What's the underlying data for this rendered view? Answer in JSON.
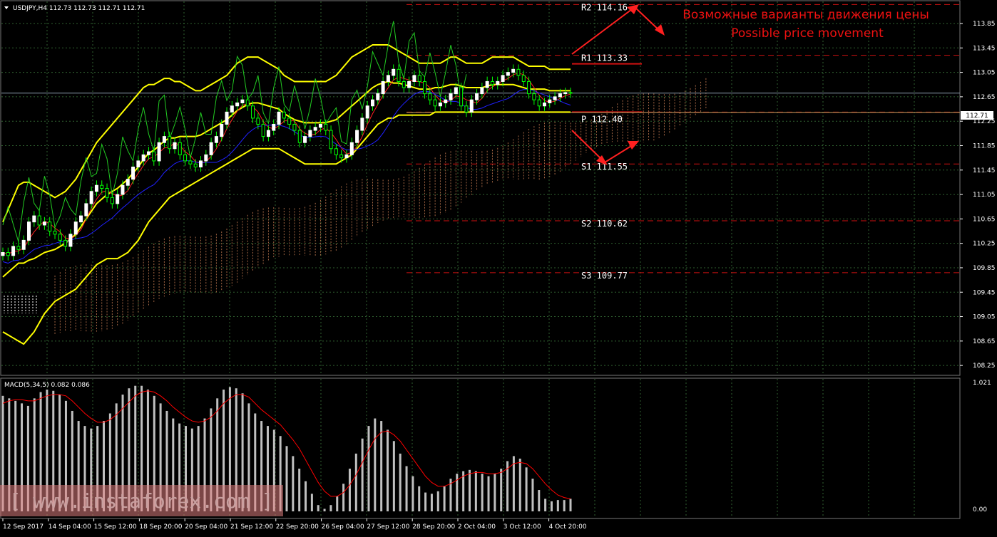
{
  "header": {
    "symbol_line": "USDJPY,H4  112.73 112.73 112.71 112.71"
  },
  "macd_header": "MACD(5,34,5) 0.082 0.086",
  "annotation": {
    "line1": "Возможные варианты движения цены",
    "line2": "Possible price movement"
  },
  "watermark": "[ www.instaforex.com ]",
  "price_tag": "112.71",
  "colors": {
    "background": "#000000",
    "grid": "#2f5f2f",
    "bull": "#ffffff",
    "bear": "#00ff00",
    "bollinger": "#ffff00",
    "tenkan": "#ff2020",
    "kijun": "#2020ff",
    "chikou": "#22cc22",
    "cloud": "#c07850",
    "levels": "#d01010",
    "annotation": "#ff2020",
    "macd_hist": "#c0c0c0",
    "macd_signal": "#ff0000"
  },
  "chart_data": [
    {
      "type": "line",
      "title": "USDJPY,H4",
      "ylim": [
        108.1,
        114.2
      ],
      "y_ticks": [
        "113.85",
        "113.45",
        "113.05",
        "112.65",
        "112.25",
        "111.85",
        "111.45",
        "111.05",
        "110.65",
        "110.25",
        "109.85",
        "109.45",
        "109.05",
        "108.65",
        "108.25"
      ],
      "x_labels": [
        "12 Sep 2017",
        "14 Sep 04:00",
        "15 Sep 12:00",
        "18 Sep 20:00",
        "20 Sep 04:00",
        "21 Sep 12:00",
        "22 Sep 20:00",
        "26 Sep 04:00",
        "27 Sep 12:00",
        "28 Sep 20:00",
        "2 Oct 04:00",
        "3 Oct 12:00",
        "4 Oct 20:00"
      ],
      "levels": [
        {
          "name": "R2",
          "value": "114.16",
          "label": "R2 114.16"
        },
        {
          "name": "R1",
          "value": "113.33",
          "label": "R1 113.33"
        },
        {
          "name": "P",
          "value": "112.40",
          "label": "P 112.40"
        },
        {
          "name": "S1",
          "value": "111.55",
          "label": "S1 111.55"
        },
        {
          "name": "S2",
          "value": "110.62",
          "label": "S2 110.62"
        },
        {
          "name": "S3",
          "value": "109.77",
          "label": "S3 109.77"
        }
      ],
      "last_price": 112.71,
      "close": [
        110.1,
        110.05,
        110.2,
        110.15,
        110.3,
        110.6,
        110.7,
        110.55,
        110.6,
        110.45,
        110.4,
        110.3,
        110.2,
        110.4,
        110.6,
        110.7,
        110.9,
        111.1,
        111.2,
        111.15,
        111.0,
        110.9,
        111.05,
        111.2,
        111.3,
        111.5,
        111.6,
        111.7,
        111.75,
        111.6,
        111.9,
        112.0,
        111.8,
        111.9,
        111.7,
        111.6,
        111.55,
        111.5,
        111.6,
        111.7,
        111.9,
        112.0,
        112.2,
        112.4,
        112.5,
        112.55,
        112.6,
        112.5,
        112.3,
        112.2,
        112.0,
        112.1,
        112.2,
        112.4,
        112.3,
        112.2,
        112.1,
        111.9,
        112.0,
        112.1,
        112.15,
        112.2,
        112.1,
        111.8,
        111.7,
        111.65,
        111.7,
        111.9,
        112.1,
        112.3,
        112.5,
        112.6,
        112.7,
        112.9,
        113.0,
        113.1,
        112.9,
        112.8,
        112.9,
        113.0,
        112.9,
        112.7,
        112.6,
        112.5,
        112.55,
        112.6,
        112.7,
        112.8,
        112.5,
        112.4,
        112.6,
        112.7,
        112.8,
        112.9,
        112.85,
        112.9,
        113.0,
        113.05,
        113.1,
        113.0,
        112.9,
        112.7,
        112.6,
        112.5,
        112.55,
        112.6,
        112.65,
        112.7,
        112.72,
        112.71
      ],
      "bb_upper": [
        110.6,
        110.8,
        111.0,
        111.2,
        111.25,
        111.25,
        111.2,
        111.15,
        111.1,
        111.05,
        111.0,
        111.05,
        111.1,
        111.2,
        111.3,
        111.45,
        111.6,
        111.75,
        111.9,
        112.0,
        112.1,
        112.2,
        112.3,
        112.4,
        112.5,
        112.6,
        112.7,
        112.8,
        112.85,
        112.85,
        112.9,
        112.95,
        112.95,
        112.9,
        112.9,
        112.85,
        112.8,
        112.75,
        112.75,
        112.8,
        112.85,
        112.9,
        112.95,
        113.0,
        113.1,
        113.2,
        113.25,
        113.3,
        113.3,
        113.3,
        113.25,
        113.2,
        113.15,
        113.1,
        113.0,
        112.95,
        112.9,
        112.9,
        112.9,
        112.9,
        112.9,
        112.9,
        112.9,
        112.95,
        113.0,
        113.1,
        113.2,
        113.3,
        113.35,
        113.4,
        113.45,
        113.5,
        113.5,
        113.5,
        113.5,
        113.45,
        113.4,
        113.35,
        113.3,
        113.25,
        113.2,
        113.2,
        113.2,
        113.2,
        113.2,
        113.25,
        113.3,
        113.3,
        113.25,
        113.2,
        113.2,
        113.2,
        113.2,
        113.25,
        113.3,
        113.3,
        113.3,
        113.3,
        113.3,
        113.25,
        113.2,
        113.15,
        113.15,
        113.15,
        113.15,
        113.1,
        113.1,
        113.1,
        113.1,
        113.1
      ],
      "bb_lower": [
        108.8,
        108.75,
        108.7,
        108.65,
        108.6,
        108.7,
        108.8,
        108.95,
        109.1,
        109.2,
        109.3,
        109.35,
        109.4,
        109.45,
        109.5,
        109.6,
        109.7,
        109.8,
        109.9,
        109.95,
        110.0,
        110.0,
        110.0,
        110.05,
        110.1,
        110.2,
        110.3,
        110.45,
        110.6,
        110.7,
        110.8,
        110.9,
        111.0,
        111.05,
        111.1,
        111.15,
        111.2,
        111.25,
        111.3,
        111.35,
        111.4,
        111.45,
        111.5,
        111.55,
        111.6,
        111.65,
        111.7,
        111.75,
        111.8,
        111.8,
        111.8,
        111.8,
        111.8,
        111.8,
        111.75,
        111.7,
        111.65,
        111.6,
        111.55,
        111.55,
        111.55,
        111.55,
        111.55,
        111.55,
        111.55,
        111.6,
        111.65,
        111.7,
        111.8,
        111.9,
        112.0,
        112.1,
        112.2,
        112.25,
        112.3,
        112.3,
        112.35,
        112.35,
        112.35,
        112.35,
        112.35,
        112.35,
        112.35,
        112.4,
        112.4,
        112.4,
        112.4,
        112.4,
        112.4,
        112.4,
        112.4,
        112.4,
        112.4,
        112.4,
        112.4,
        112.4,
        112.4,
        112.4,
        112.4,
        112.4,
        112.4,
        112.4,
        112.4,
        112.4,
        112.4,
        112.4,
        112.4,
        112.4,
        112.4,
        112.4
      ],
      "macd": {
        "ylim": [
          0,
          1.021
        ],
        "ticks": [
          "1.021",
          "0.00"
        ],
        "histogram": [
          0.92,
          0.9,
          0.88,
          0.86,
          0.84,
          0.9,
          0.95,
          0.97,
          0.96,
          0.93,
          0.88,
          0.8,
          0.72,
          0.68,
          0.66,
          0.68,
          0.72,
          0.78,
          0.86,
          0.93,
          0.98,
          1.0,
          1.0,
          0.97,
          0.92,
          0.86,
          0.8,
          0.74,
          0.7,
          0.68,
          0.66,
          0.68,
          0.74,
          0.82,
          0.9,
          0.97,
          0.99,
          0.98,
          0.94,
          0.86,
          0.78,
          0.72,
          0.68,
          0.65,
          0.6,
          0.52,
          0.44,
          0.34,
          0.24,
          0.14,
          0.05,
          0.02,
          0.05,
          0.12,
          0.22,
          0.34,
          0.46,
          0.58,
          0.68,
          0.74,
          0.72,
          0.65,
          0.56,
          0.46,
          0.36,
          0.28,
          0.2,
          0.15,
          0.14,
          0.16,
          0.2,
          0.26,
          0.3,
          0.32,
          0.33,
          0.32,
          0.3,
          0.28,
          0.3,
          0.34,
          0.4,
          0.44,
          0.42,
          0.35,
          0.26,
          0.17,
          0.1,
          0.08,
          0.09,
          0.09,
          0.1
        ],
        "signal": [
          0.86,
          0.88,
          0.89,
          0.89,
          0.88,
          0.88,
          0.9,
          0.92,
          0.93,
          0.93,
          0.92,
          0.88,
          0.83,
          0.78,
          0.74,
          0.71,
          0.71,
          0.73,
          0.77,
          0.82,
          0.87,
          0.92,
          0.95,
          0.96,
          0.95,
          0.92,
          0.88,
          0.83,
          0.79,
          0.75,
          0.72,
          0.71,
          0.72,
          0.75,
          0.8,
          0.86,
          0.9,
          0.93,
          0.93,
          0.91,
          0.86,
          0.81,
          0.77,
          0.73,
          0.69,
          0.63,
          0.57,
          0.5,
          0.41,
          0.32,
          0.23,
          0.16,
          0.12,
          0.12,
          0.15,
          0.21,
          0.29,
          0.39,
          0.49,
          0.58,
          0.63,
          0.64,
          0.61,
          0.56,
          0.49,
          0.42,
          0.35,
          0.28,
          0.23,
          0.2,
          0.2,
          0.22,
          0.25,
          0.28,
          0.3,
          0.31,
          0.31,
          0.3,
          0.3,
          0.31,
          0.34,
          0.38,
          0.39,
          0.38,
          0.34,
          0.28,
          0.22,
          0.17,
          0.13,
          0.11,
          0.1
        ]
      }
    }
  ]
}
